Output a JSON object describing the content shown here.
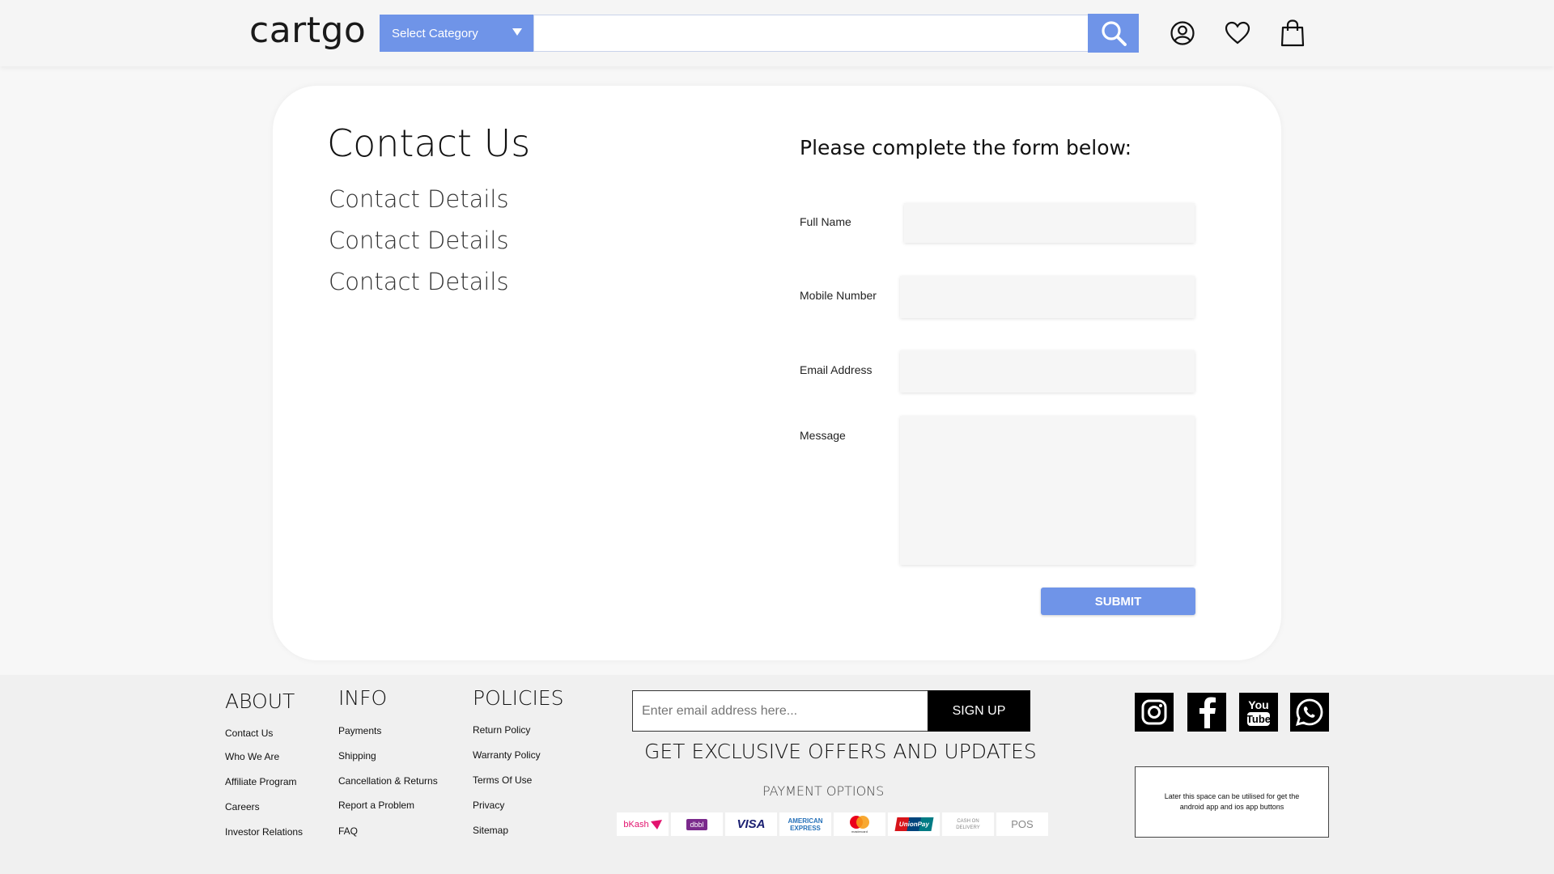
{
  "header": {
    "logo": "cartgo",
    "category_label": "Select Category",
    "search_placeholder": ""
  },
  "contact": {
    "title": "Contact Us",
    "details": [
      "Contact Details",
      "Contact Details",
      "Contact Details"
    ]
  },
  "form": {
    "heading": "Please complete the form below:",
    "full_name_label": "Full Name",
    "mobile_label": "Mobile Number",
    "email_label": "Email Address",
    "message_label": "Message",
    "submit_label": "SUBMIT"
  },
  "footer": {
    "about": {
      "heading": "ABOUT",
      "links": [
        "Contact Us",
        "Who We Are",
        "Affiliate Program",
        "Careers",
        "Investor Relations"
      ]
    },
    "info": {
      "heading": "INFO",
      "links": [
        "Payments",
        "Shipping",
        "Cancellation & Returns",
        "Report a Problem",
        "FAQ"
      ]
    },
    "policies": {
      "heading": "POLICIES",
      "links": [
        "Return Policy",
        "Warranty Policy",
        "Terms Of Use",
        "Privacy",
        "Sitemap"
      ]
    },
    "newsletter": {
      "placeholder": "Enter email address here...",
      "button": "SIGN UP",
      "tagline": "GET EXCLUSIVE OFFERS AND UPDATES"
    },
    "payment_title": "PAYMENT OPTIONS",
    "payments": [
      {
        "label": "bKash",
        "color": "#e2136e"
      },
      {
        "label": "dbbl",
        "color": "#7b2a8c"
      },
      {
        "label": "VISA",
        "color": "#1a1f71"
      },
      {
        "label": "AMERICAN EXPRESS",
        "color": "#2671b9"
      },
      {
        "label": "mastercard",
        "color": "#eb001b"
      },
      {
        "label": "UnionPay",
        "color": "#d7141a"
      },
      {
        "label": "CASH ON DELIVERY",
        "color": "#888888"
      },
      {
        "label": "POS",
        "color": "#888888"
      }
    ],
    "social": [
      "instagram-icon",
      "facebook-icon",
      "youtube-icon",
      "whatsapp-icon"
    ],
    "app_placeholder": "Later this space can be utilised for get the android app and ios app  buttons"
  },
  "colors": {
    "accent": "#6f94e8",
    "footer_bg": "#f0f0f0"
  }
}
